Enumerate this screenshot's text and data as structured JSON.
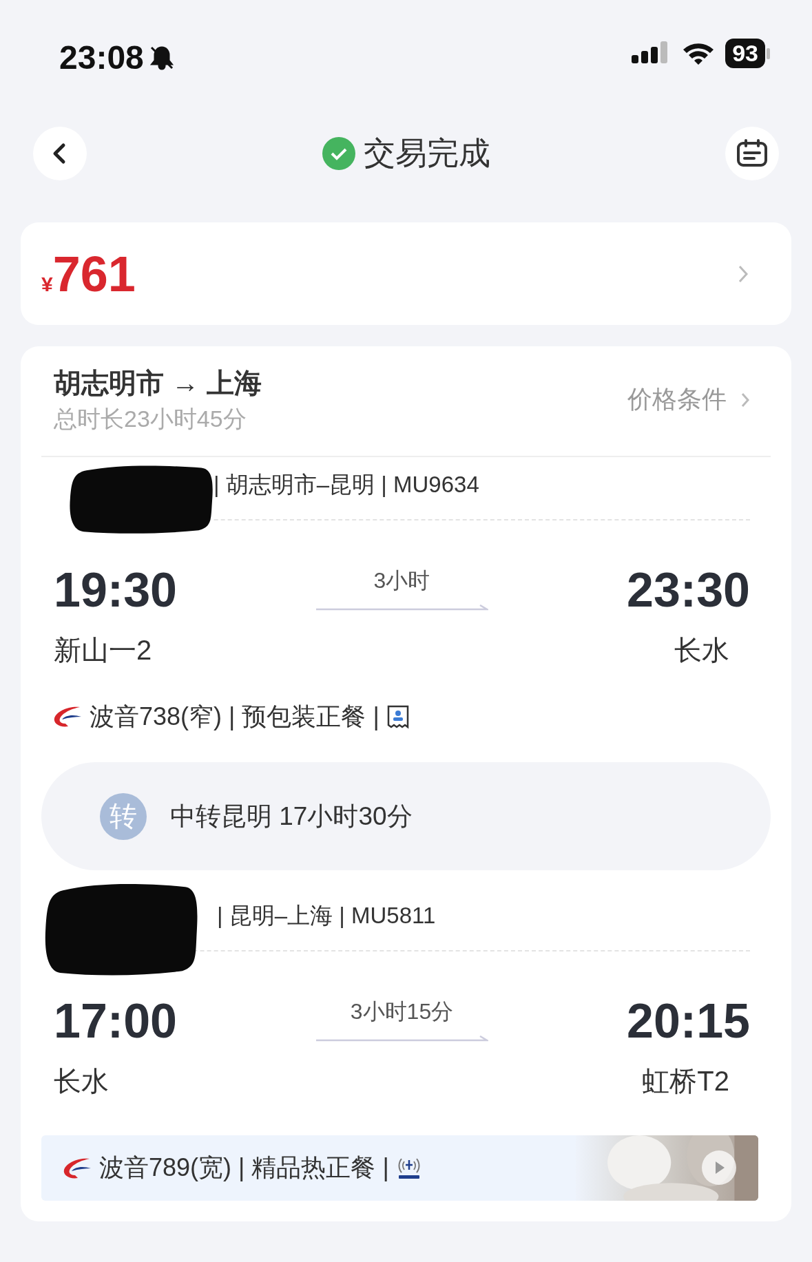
{
  "status_bar": {
    "time": "23:08",
    "battery": "93"
  },
  "header": {
    "title": "交易完成"
  },
  "price": {
    "currency": "¥",
    "amount": "761"
  },
  "trip": {
    "route": "胡志明市 → 上海",
    "total_duration": "总时长23小时45分",
    "price_terms": "价格条件"
  },
  "segments": [
    {
      "kind": "plain",
      "header": "| 胡志明市–昆明 | MU9634",
      "depart_time": "19:30",
      "depart_airport": "新山一2",
      "duration": "3小时",
      "arrive_time": "23:30",
      "arrive_airport": "长水",
      "info": "波音738(窄) | 预包装正餐 |",
      "amenity": {
        "kind": "seat"
      }
    },
    {
      "kind": "banner",
      "header": "| 昆明–上海 | MU5811",
      "depart_time": "17:00",
      "depart_airport": "长水",
      "duration": "3小时15分",
      "arrive_time": "20:15",
      "arrive_airport": "虹桥T2",
      "info": "波音789(宽) | 精品热正餐 |",
      "amenity": {
        "kind": "wifi"
      }
    }
  ],
  "transfer": {
    "badge": "转",
    "text": "中转昆明 17小时30分"
  }
}
